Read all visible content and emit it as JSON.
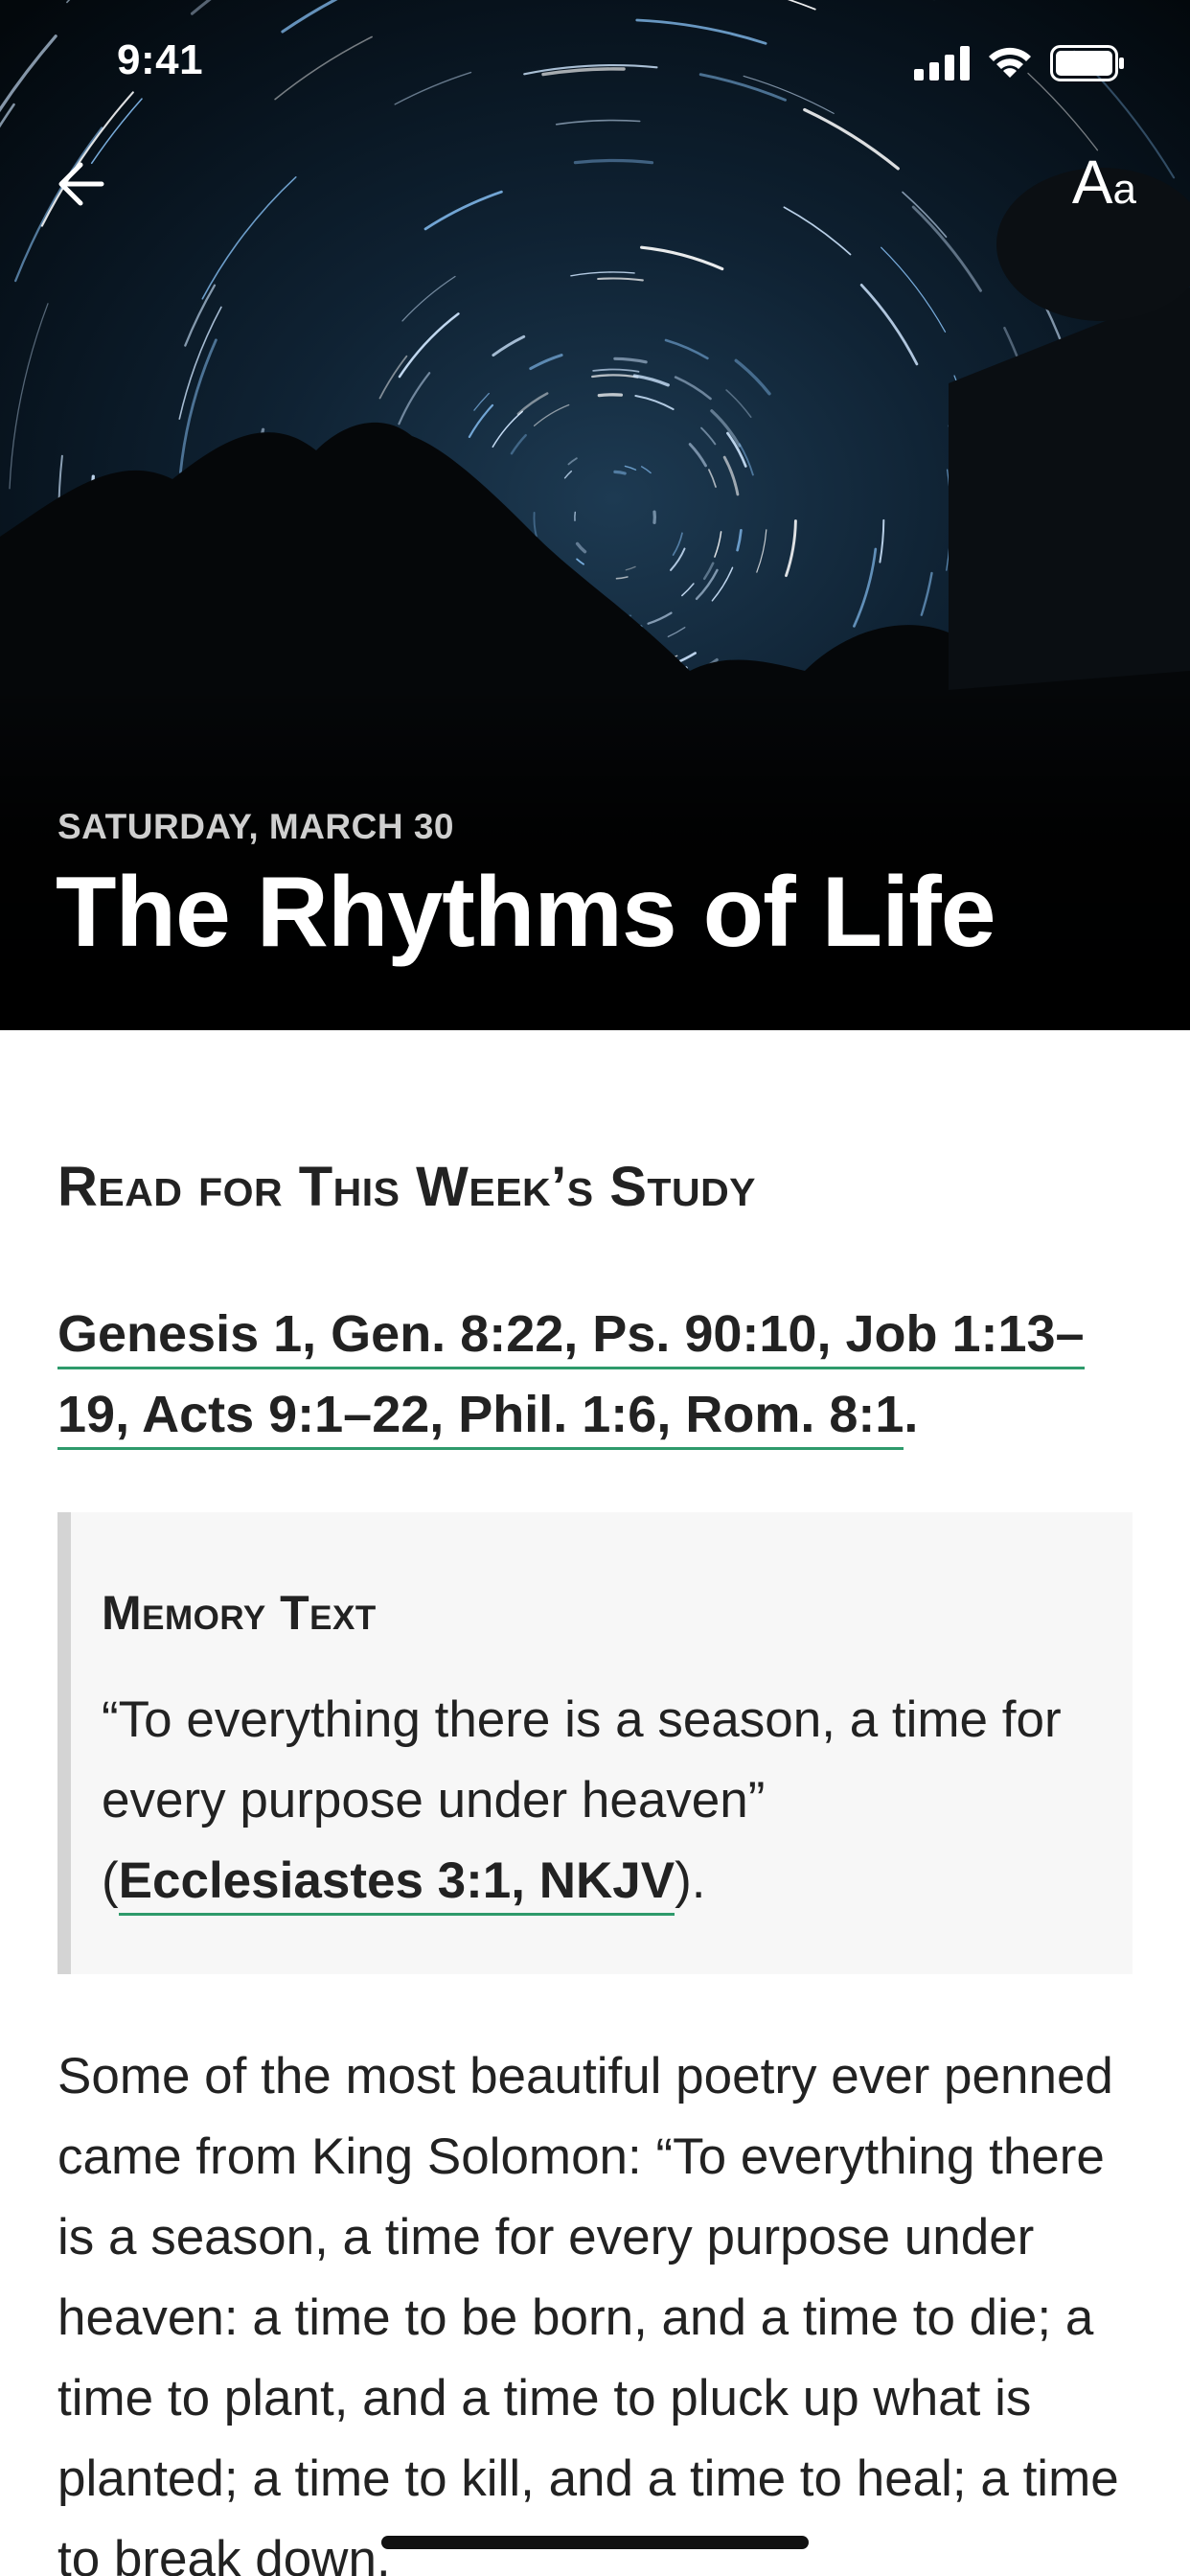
{
  "status_bar": {
    "time": "9:41",
    "icons": [
      "cellular-signal-icon",
      "wifi-icon",
      "battery-icon"
    ]
  },
  "nav": {
    "back_icon": "arrow-left-icon",
    "font_settings": {
      "large": "A",
      "small": "a"
    }
  },
  "hero": {
    "image": "star-trails-night-sky",
    "date": "SATURDAY, MARCH 30",
    "title": "The Rhythms of Life"
  },
  "read_section": {
    "heading": "Read for This Week’s Study",
    "refs_line1": "Genesis 1, Gen. 8:22, Ps. 90:10, Job 1:13–",
    "refs_line2": "19, Acts 9:1–22, Phil. 1:6, Rom. 8:1",
    "refs_suffix": "."
  },
  "memory_text": {
    "heading": "Memory Text",
    "quote": "“To everything there is a season, a time for every purpose under heaven” (",
    "reference": "Ecclesiastes 3:1, NKJV",
    "closing": ")."
  },
  "body": {
    "paragraph": "Some of the most beautiful poetry ever penned came from King Solomon: “To everything there is a season, a time for every purpose under heaven: a time to be born, and a time to die; a time to plant, and a time to pluck up what is planted; a time to kill, and a time to heal; a time to break down,"
  },
  "colors": {
    "link_underline": "#2e9a6b",
    "memory_bg": "#f7f7f7",
    "memory_border": "#d4d4d4"
  }
}
